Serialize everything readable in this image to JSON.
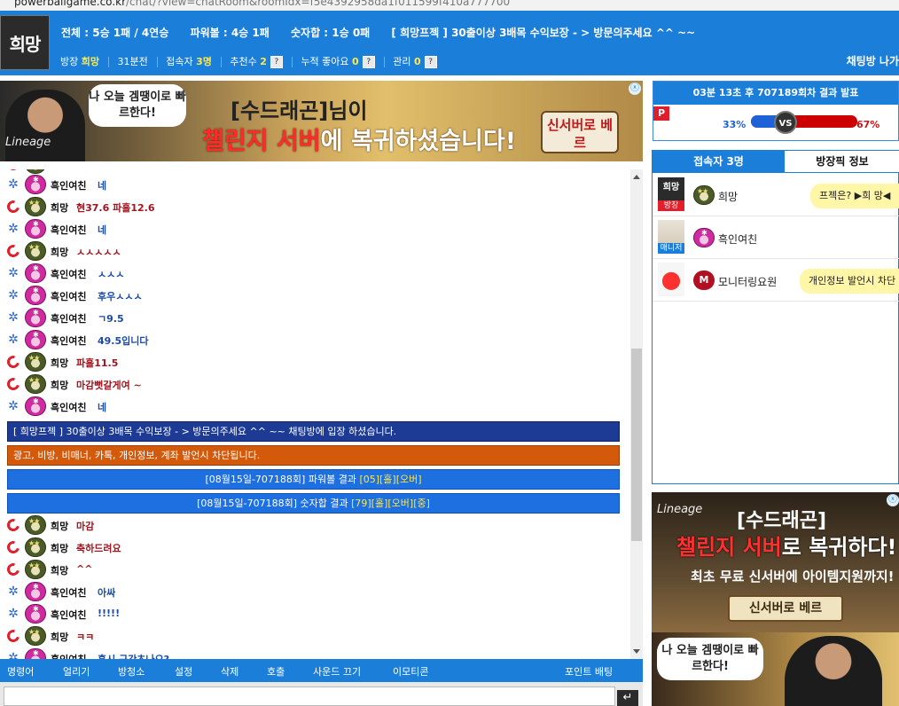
{
  "url": {
    "host": "powerballgame.co.kr",
    "path": "/chat/?view=chatRoom&roomIdx=f5e4392958da1f011599f410a777700"
  },
  "header": {
    "logo": "희망",
    "stats": [
      "전체 : 5승 1패 / 4연승",
      "파워볼 : 4승 1패",
      "숫자합 : 1승 0패",
      "[ 희망프젝 ] 30출이상 3배목 수익보장 - > 방문의주세요 ^^ ~~"
    ],
    "info": {
      "room_label": "방장",
      "room_value": "희망",
      "time": "31분전",
      "visitors_label": "접속자",
      "visitors_value": "3명",
      "recommend_label": "추천수",
      "recommend_value": "2",
      "likes_label": "누적 좋아요",
      "likes_value": "0",
      "manage_label": "관리",
      "manage_value": "0",
      "q": "?"
    },
    "exit": "채팅방 나가"
  },
  "ad1": {
    "bubble": "나 오늘 겜땡이로 빠르한다!",
    "lineage": "Lineage",
    "t1": "[수드래곤]님이",
    "t2a": "챌린지 서버",
    "t2b": "에 복귀하셨습니다!",
    "badge": "신서버로 베르",
    "x": "ⓧ"
  },
  "chat": {
    "messages": [
      {
        "level": "blu",
        "avatar": "pk",
        "name": "흑인여친",
        "text": "네",
        "color": "blue"
      },
      {
        "level": "red",
        "avatar": "mil",
        "name": "희망",
        "text": "현37.6 파홀12.6",
        "color": "red"
      },
      {
        "level": "blu",
        "avatar": "pk",
        "name": "흑인여친",
        "text": "네",
        "color": "blue"
      },
      {
        "level": "red",
        "avatar": "mil",
        "name": "희망",
        "text": "ㅅㅅㅅㅅㅅ",
        "color": "red"
      },
      {
        "level": "blu",
        "avatar": "pk",
        "name": "흑인여친",
        "text": "ㅅㅅㅅ",
        "color": "blue"
      },
      {
        "level": "blu",
        "avatar": "pk",
        "name": "흑인여친",
        "text": "후우ㅅㅅㅅ",
        "color": "blue"
      },
      {
        "level": "blu",
        "avatar": "pk",
        "name": "흑인여친",
        "text": "ㄱ9.5",
        "color": "blue"
      },
      {
        "level": "blu",
        "avatar": "pk",
        "name": "흑인여친",
        "text": "49.5입니다",
        "color": "blue"
      },
      {
        "level": "red",
        "avatar": "mil",
        "name": "희망",
        "text": "파홀11.5",
        "color": "red"
      },
      {
        "level": "red",
        "avatar": "mil",
        "name": "희망",
        "text": "마감뻣갈게여 ~",
        "color": "red"
      },
      {
        "level": "blu",
        "avatar": "pk",
        "name": "흑인여친",
        "text": "네",
        "color": "blue"
      }
    ],
    "system": [
      {
        "style": "navy",
        "text": "[ 희망프젝 ] 30출이상 3배목 수익보장 - > 방문의주세요 ^^ ~~ 채팅방에 입장 하셨습니다."
      },
      {
        "style": "orange",
        "text": "광고, 비방, 비매너, 카톡, 개인정보, 계좌 발언시 차단됩니다."
      },
      {
        "style": "sky",
        "pre": "[08월15일-707188회] 파워볼 결과 ",
        "hl": "[05][홀][오버]"
      },
      {
        "style": "sky",
        "pre": "[08월15일-707188회] 숫자합 결과 ",
        "hl": "[79][홀][오버][중]"
      }
    ],
    "messages2": [
      {
        "level": "red",
        "avatar": "mil",
        "name": "희망",
        "text": "마감",
        "color": "red"
      },
      {
        "level": "red",
        "avatar": "mil",
        "name": "희망",
        "text": "축하드려요",
        "color": "red"
      },
      {
        "level": "red",
        "avatar": "mil",
        "name": "희망",
        "text": "^^",
        "color": "red"
      },
      {
        "level": "blu",
        "avatar": "pk",
        "name": "흑인여친",
        "text": "아싸",
        "color": "blue"
      },
      {
        "level": "blu",
        "avatar": "pk",
        "name": "흑인여친",
        "text": "!!!!!",
        "color": "blue"
      },
      {
        "level": "red",
        "avatar": "mil",
        "name": "희망",
        "text": "ㅋㅋ",
        "color": "red"
      },
      {
        "level": "blu",
        "avatar": "pk",
        "name": "흑인여친",
        "text": "혹시 구간초나오?",
        "color": "blue"
      }
    ]
  },
  "tabs": [
    "명령어",
    "얼리기",
    "방청소",
    "설정",
    "삭제",
    "호출",
    "사운드 끄기",
    "이모티콘",
    "포인트 배팅"
  ],
  "input": {
    "value": "",
    "send": "↵"
  },
  "result": {
    "header": "03분 13초 후 707189회차 결과 발표",
    "p": "P",
    "left_pct": "33%",
    "right_pct": "67%",
    "left_value": 33,
    "vs": "VS"
  },
  "users": {
    "tab_active": "접속자 3명",
    "tab_other": "방장픽 정보",
    "list": [
      {
        "pic_text": "희망",
        "role": "방장",
        "role_color": "#e0202a",
        "avatar": "mil",
        "name": "희망",
        "tip": "프젝은? ▶희 망◀"
      },
      {
        "pic_text": "",
        "role": "매니저",
        "role_color": "#1b7fd9",
        "avatar": "pk",
        "name": "흑인여친",
        "tip": ""
      },
      {
        "pic_text": "",
        "role": "",
        "role_color": "",
        "avatar": "mon",
        "name": "모니터링요원",
        "tip": "개인정보 발언시 차단"
      }
    ]
  },
  "ad2": {
    "lineage": "Lineage",
    "a1": "[수드래곤]",
    "a2a": "챌린지 서버",
    "a2b": "로 복귀하다!",
    "a3": "최초 무료 신서버에 아이템지원까지!",
    "a4": "신서버로 베르",
    "bubble": "나 오늘 겜땡이로 빠르한다!",
    "x": "ⓧ"
  }
}
